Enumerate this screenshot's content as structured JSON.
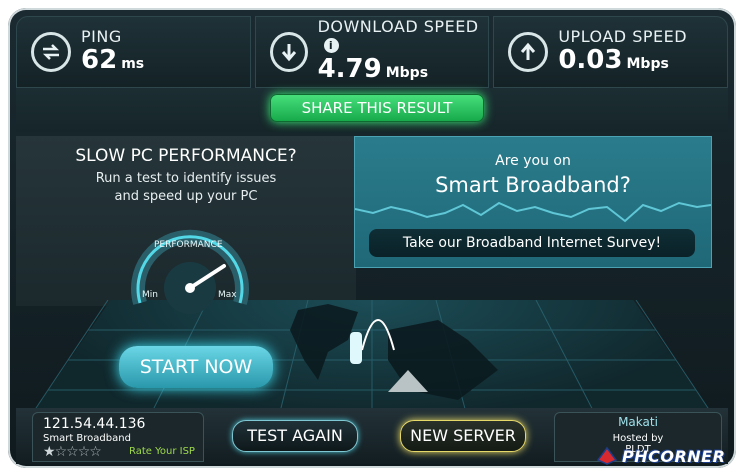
{
  "metrics": {
    "ping": {
      "label": "PING",
      "value": "62",
      "unit": "ms",
      "icon": "ping-arrows-icon"
    },
    "download": {
      "label": "DOWNLOAD SPEED",
      "value": "4.79",
      "unit": "Mbps",
      "icon": "download-arrow-icon",
      "info": "i"
    },
    "upload": {
      "label": "UPLOAD SPEED",
      "value": "0.03",
      "unit": "Mbps",
      "icon": "upload-arrow-icon"
    }
  },
  "share_button": "SHARE THIS RESULT",
  "left_ad": {
    "title": "SLOW PC PERFORMANCE?",
    "line1": "Run a test to identify issues",
    "line2": "and speed up your PC",
    "gauge_label": "PERFORMANCE",
    "gauge_min": "Min",
    "gauge_max": "Max",
    "gauge_level": 0.8,
    "start_button": "START NOW"
  },
  "right_ad": {
    "line1": "Are you on",
    "line2": "Smart Broadband?",
    "survey_button": "Take our Broadband Internet Survey!"
  },
  "isp": {
    "ip": "121.54.44.136",
    "name": "Smart Broadband",
    "rating": 1,
    "rating_max": 5,
    "rate_link": "Rate Your ISP"
  },
  "buttons": {
    "test_again": "TEST AGAIN",
    "new_server": "NEW SERVER"
  },
  "server": {
    "city": "Makati",
    "hosted_by": "Hosted by",
    "host": "PLDT"
  },
  "watermark": {
    "text": "PHCORNER"
  },
  "colors": {
    "accent_green": "#2fd06a",
    "accent_cyan": "#3ee2f5",
    "accent_yellow": "#f2e36a",
    "panel_dark": "#142226",
    "survey_teal": "#2a7c8c"
  }
}
